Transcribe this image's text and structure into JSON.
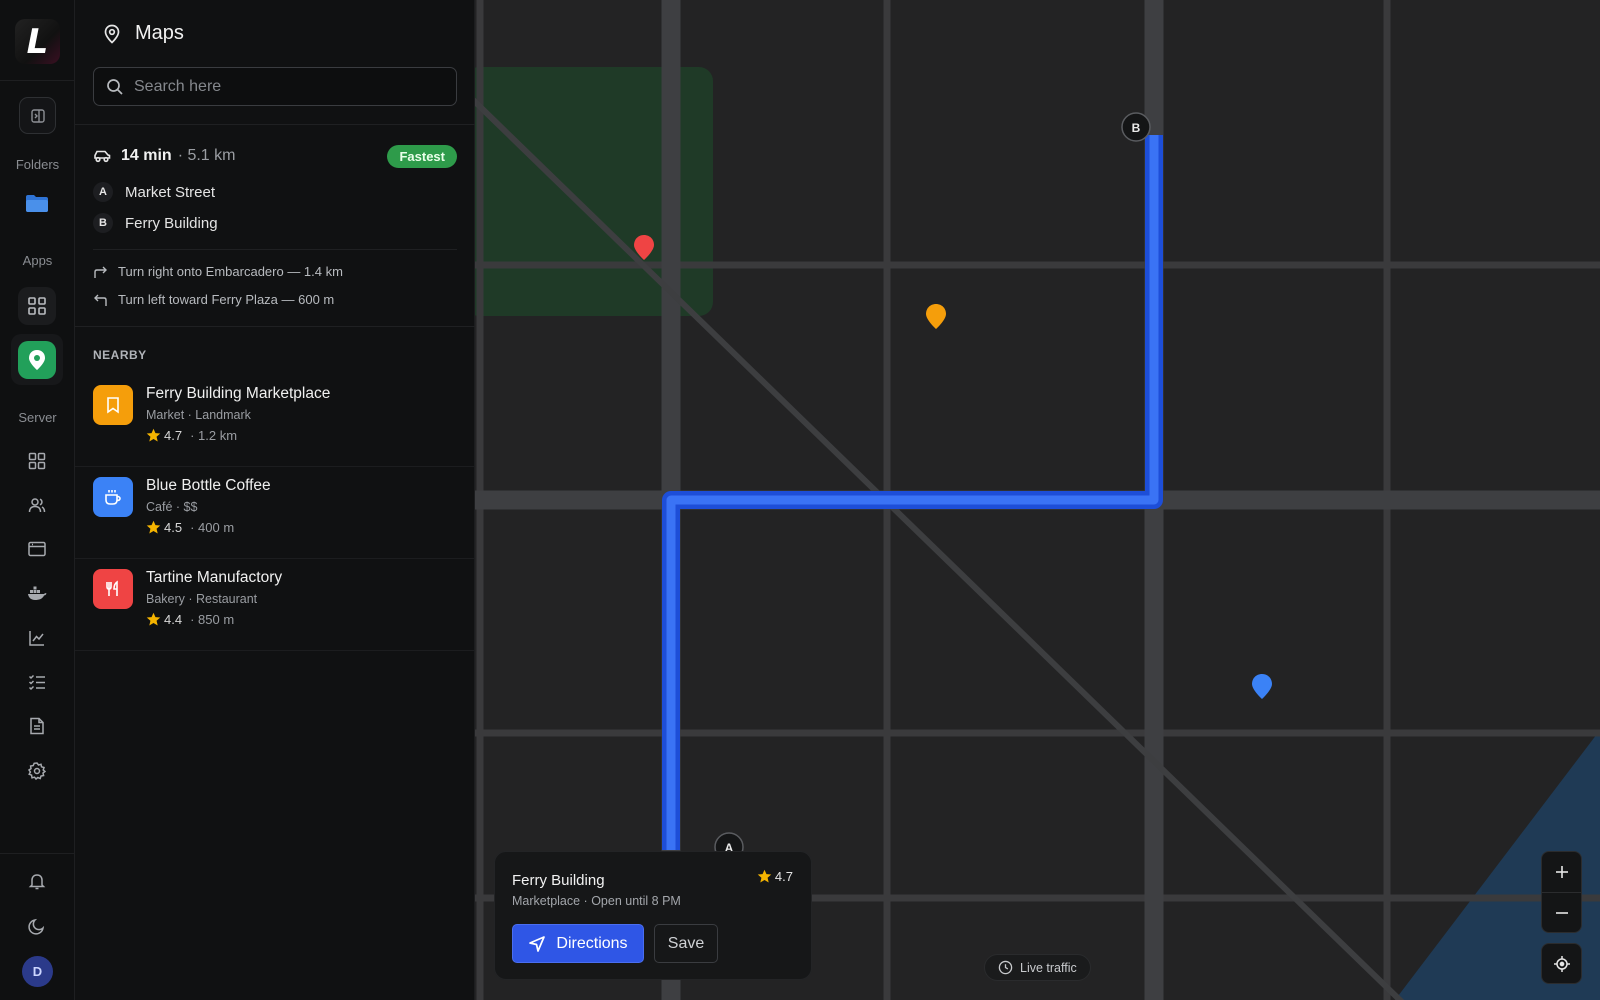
{
  "app": {
    "logo_letter": "L"
  },
  "rail": {
    "folders_label": "Folders",
    "apps_label": "Apps",
    "server_label": "Server",
    "server_icons": [
      "grid-icon",
      "users-icon",
      "browser-window-icon",
      "docker-whale-icon",
      "line-chart-icon",
      "checklist-icon",
      "document-icon",
      "gear-icon"
    ],
    "bottom_icons": [
      "bell-icon",
      "moon-icon"
    ],
    "avatar_initial": "D"
  },
  "panel": {
    "title": "Maps",
    "search_placeholder": "Search here",
    "route": {
      "time": "14 min",
      "distance": "· 5.1 km",
      "badge": "Fastest",
      "badge_color": "#2e9b4a",
      "stops": [
        {
          "marker": "A",
          "label": "Market Street"
        },
        {
          "marker": "B",
          "label": "Ferry Building"
        }
      ],
      "steps": [
        {
          "icon": "turn-right-icon",
          "text": "Turn right onto Embarcadero — 1.4 km"
        },
        {
          "icon": "turn-left-icon",
          "text": "Turn left toward Ferry Plaza — 600 m"
        }
      ]
    },
    "nearby_title": "NEARBY",
    "nearby": [
      {
        "name": "Ferry Building Marketplace",
        "sub": "Market · Landmark",
        "rating": "4.7",
        "distance": "· 1.2 km",
        "icon": "bookmark-icon",
        "color": "#f59e0b"
      },
      {
        "name": "Blue Bottle Coffee",
        "sub": "Café · $$",
        "rating": "4.5",
        "distance": "· 400 m",
        "icon": "coffee-cup-icon",
        "color": "#3b82f6"
      },
      {
        "name": "Tartine Manufactory",
        "sub": "Bakery · Restaurant",
        "rating": "4.4",
        "distance": "· 850 m",
        "icon": "fork-knife-icon",
        "color": "#ef4444"
      }
    ]
  },
  "map": {
    "route_color": "#2563eb",
    "marker_a": "A",
    "marker_b": "B",
    "pin_colors": [
      "#ef4444",
      "#f59e0b",
      "#3b82f6"
    ],
    "card": {
      "name": "Ferry Building",
      "sub": "Marketplace · Open until 8 PM",
      "rating": "4.7",
      "directions_label": "Directions",
      "save_label": "Save"
    },
    "traffic_label": "Live traffic",
    "zoom_in": "+",
    "zoom_out": "−"
  }
}
